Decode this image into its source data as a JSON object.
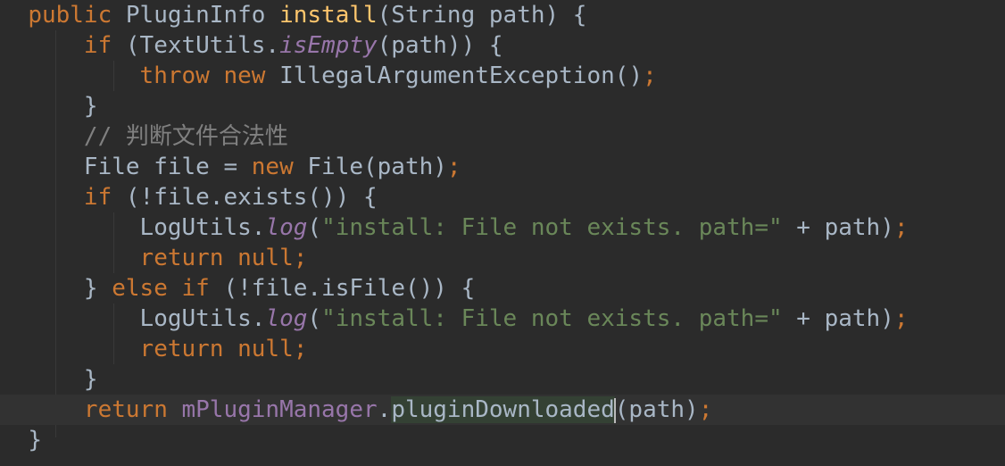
{
  "code": {
    "l1": [
      "public",
      " PluginInfo ",
      "install",
      "(String path) {"
    ],
    "l2": [
      "if",
      " (TextUtils.",
      "isEmpty",
      "(path)) {"
    ],
    "l3": [
      "throw",
      " ",
      "new",
      " IllegalArgumentException()",
      ";"
    ],
    "l4": [
      "}"
    ],
    "l5": [
      "// 判断文件合法性"
    ],
    "l6": [
      "File file = ",
      "new",
      " File(path)",
      ";"
    ],
    "l7": [
      "if",
      " (!file.exists()) {"
    ],
    "l8": [
      "LogUtils.",
      "log",
      "(",
      "\"install: File not exists. path=\"",
      " + path)",
      ";"
    ],
    "l9": [
      "return",
      " ",
      "null",
      ";"
    ],
    "l10": [
      "} ",
      "else",
      " ",
      "if",
      " (!file.isFile()) {"
    ],
    "l11": [
      "LogUtils.",
      "log",
      "(",
      "\"install: File not exists. path=\"",
      " + path)",
      ";"
    ],
    "l12": [
      "return",
      " ",
      "null",
      ";"
    ],
    "l13": [
      "}"
    ],
    "l14": [
      "return",
      " ",
      "mPluginManager",
      ".",
      "pluginDownloaded",
      "(path)",
      ";"
    ],
    "l15": [
      "}"
    ]
  },
  "colors": {
    "background": "#2b2b2b",
    "current_line": "#323232",
    "default_text": "#a9b7c6",
    "keyword": "#cc7832",
    "method_declaration": "#ffc66d",
    "field": "#9876aa",
    "string": "#6a8759",
    "comment": "#808080"
  }
}
